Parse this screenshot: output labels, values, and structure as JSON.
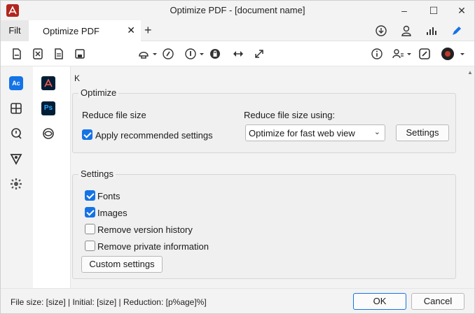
{
  "window": {
    "title": "Optimize PDF - [document name]",
    "minimize": "–",
    "maximize": "☐",
    "close": "✕"
  },
  "tabs": {
    "filter_label": "Filt",
    "active_label": "Optimize PDF",
    "close_glyph": "✕",
    "add_glyph": "+"
  },
  "main": {
    "heading": "K",
    "optimize": {
      "legend": "Optimize",
      "reduce_label": "Reduce file size",
      "apply_recommended": "Apply recommended settings",
      "apply_recommended_checked": true,
      "reduce_using_label": "Reduce file size using:",
      "reduce_using_value": "Optimize for fast web view",
      "settings_button": "Settings"
    },
    "settings": {
      "legend": "Settings",
      "items": [
        {
          "label": "Fonts",
          "checked": true
        },
        {
          "label": "Images",
          "checked": true
        },
        {
          "label": "Remove version history",
          "checked": false
        },
        {
          "label": "Remove private information",
          "checked": false
        }
      ],
      "custom_button": "Custom settings"
    }
  },
  "status": {
    "text": "File size: [size] | Initial: [size] | Reduction: [p%age]%]",
    "ok": "OK",
    "cancel": "Cancel"
  },
  "colors": {
    "accent": "#1473e6",
    "app_red": "#b3261e",
    "ps_navy": "#001e36"
  }
}
